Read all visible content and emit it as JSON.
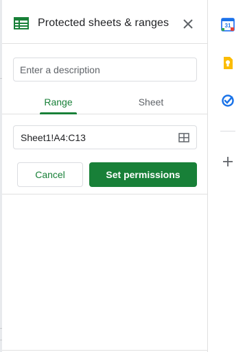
{
  "panel": {
    "title": "Protected sheets & ranges",
    "description": {
      "placeholder": "Enter a description",
      "value": ""
    },
    "tabs": [
      {
        "label": "Range",
        "active": true
      },
      {
        "label": "Sheet",
        "active": false
      }
    ],
    "range": {
      "value": "Sheet1!A4:C13"
    },
    "buttons": {
      "cancel": "Cancel",
      "set_permissions": "Set permissions"
    }
  },
  "side_rail": {
    "icons": [
      "calendar-icon",
      "keep-icon",
      "tasks-icon",
      "add-icon"
    ],
    "calendar_day": "31"
  },
  "colors": {
    "accent": "#188038",
    "border": "#dadce0",
    "text": "#202124",
    "muted": "#5f6368",
    "keep": "#fbbc04",
    "tasks": "#1a73e8"
  }
}
